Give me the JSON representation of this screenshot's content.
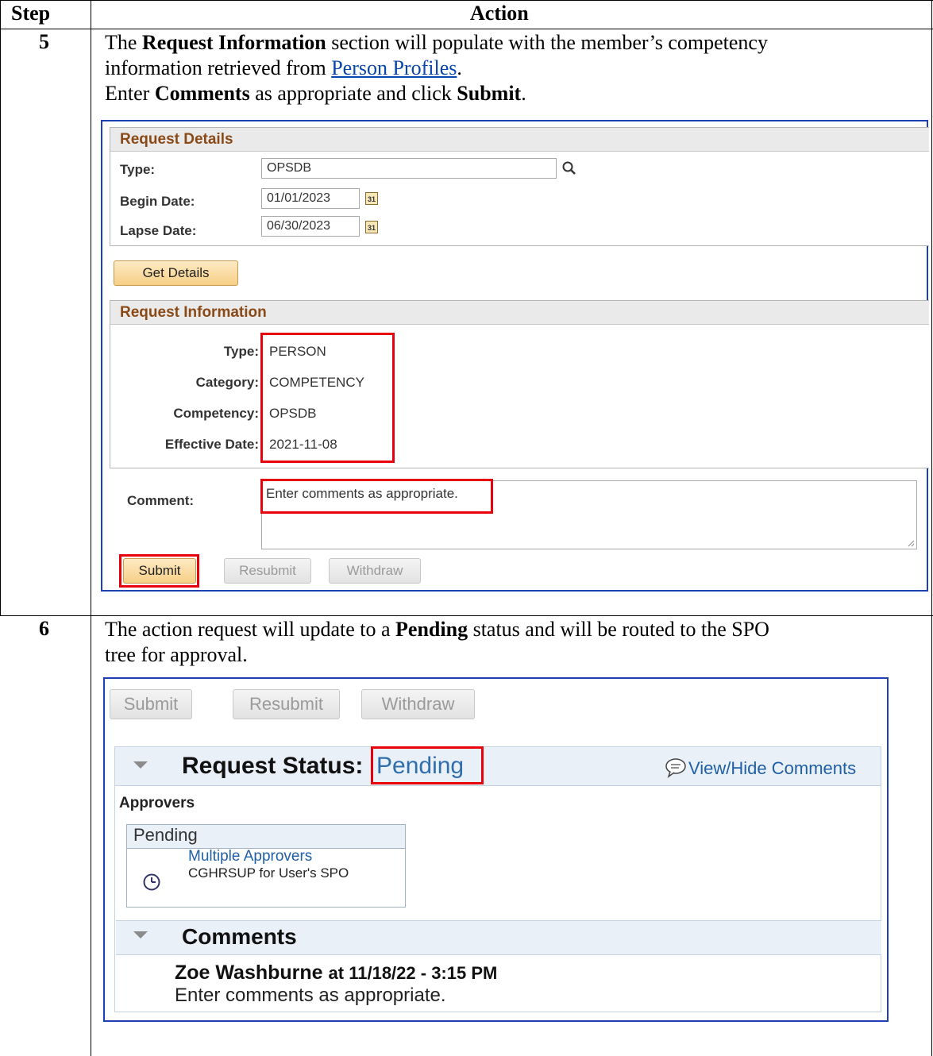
{
  "table": {
    "col_step": "Step",
    "col_action": "Action"
  },
  "step5": {
    "number": "5",
    "line1_pre": "The ",
    "line1_bold": "Request Information",
    "line1_post": " section will populate with the member’s competency",
    "line2_pre": "information retrieved from ",
    "line2_link": "Person Profiles",
    "line2_post": ".",
    "line3_pre": "Enter ",
    "line3_bold1": "Comments",
    "line3_mid": " as appropriate and click ",
    "line3_bold2": "Submit",
    "line3_post": ".",
    "screen": {
      "request_details": {
        "title": "Request Details",
        "type_label": "Type:",
        "type_value": "OPSDB",
        "begin_label": "Begin Date:",
        "begin_value": "01/01/2023",
        "lapse_label": "Lapse Date:",
        "lapse_value": "06/30/2023",
        "calendar_glyph": "31"
      },
      "get_details_button": "Get Details",
      "request_information": {
        "title": "Request Information",
        "rows": [
          {
            "label": "Type:",
            "value": "PERSON"
          },
          {
            "label": "Category:",
            "value": "COMPETENCY"
          },
          {
            "label": "Competency:",
            "value": "OPSDB"
          },
          {
            "label": "Effective Date:",
            "value": "2021-11-08"
          }
        ]
      },
      "comment_label": "Comment:",
      "comment_value": "Enter comments as appropriate.",
      "buttons": {
        "submit": "Submit",
        "resubmit": "Resubmit",
        "withdraw": "Withdraw"
      }
    }
  },
  "step6": {
    "number": "6",
    "line1_pre": "The action request will update to a ",
    "line1_bold": "Pending",
    "line1_post": " status and will be routed to the SPO",
    "line2": "tree for approval.",
    "screen": {
      "buttons": {
        "submit": "Submit",
        "resubmit": "Resubmit",
        "withdraw": "Withdraw"
      },
      "status_title": "Request Status:",
      "status_value": "Pending",
      "view_hide": "View/Hide Comments",
      "approvers_label": "Approvers",
      "approver_box": {
        "title": "Pending",
        "name": "Multiple Approvers",
        "role": "CGHRSUP for User's SPO"
      },
      "comments_title": "Comments",
      "comment_author": "Zoe Washburne",
      "comment_time": "at 11/18/22 - 3:15 PM",
      "comment_text": "Enter comments as appropriate."
    }
  },
  "colors": {
    "section_title": "#8a4a17",
    "highlight_red": "#e8000b",
    "frame_blue": "#1f3fb5",
    "link_blue": "#1f5fa5"
  }
}
